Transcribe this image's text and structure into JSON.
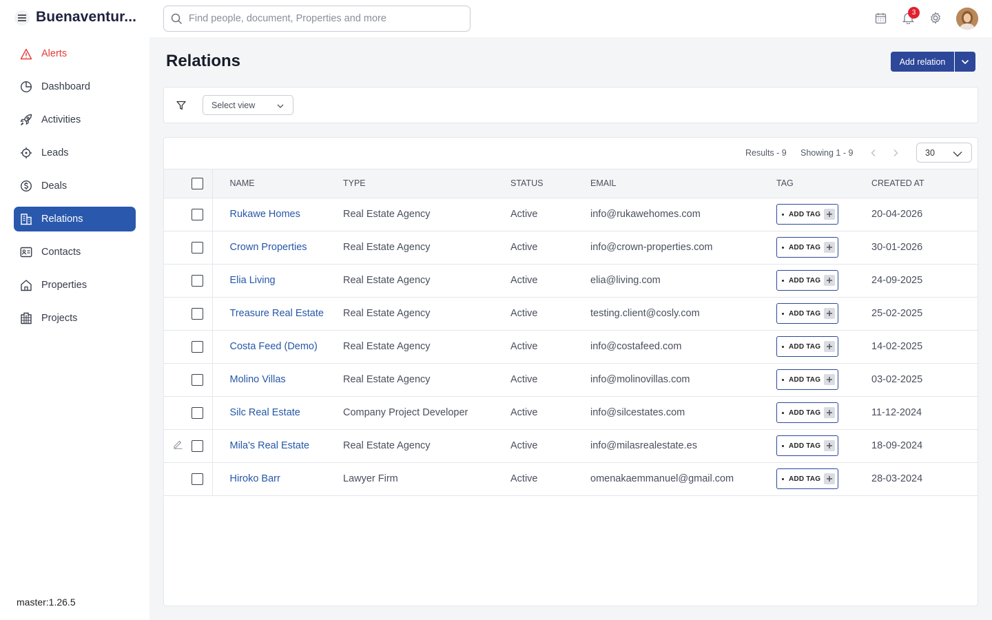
{
  "app": {
    "brand": "Buenaventur..."
  },
  "search": {
    "placeholder": "Find people, document, Properties and more"
  },
  "topbar": {
    "notification_count": "3"
  },
  "sidebar": {
    "items": [
      {
        "label": "Alerts",
        "icon": "alert-triangle-icon"
      },
      {
        "label": "Dashboard",
        "icon": "pie-chart-icon"
      },
      {
        "label": "Activities",
        "icon": "rocket-icon"
      },
      {
        "label": "Leads",
        "icon": "target-icon"
      },
      {
        "label": "Deals",
        "icon": "dollar-circle-icon"
      },
      {
        "label": "Relations",
        "icon": "building-icon"
      },
      {
        "label": "Contacts",
        "icon": "contact-card-icon"
      },
      {
        "label": "Properties",
        "icon": "home-icon"
      },
      {
        "label": "Projects",
        "icon": "grid-building-icon"
      }
    ],
    "active": "Relations",
    "version": "master:1.26.5"
  },
  "page": {
    "title": "Relations",
    "add_button": "Add relation"
  },
  "filters": {
    "select_view": "Select view"
  },
  "pager": {
    "results": "Results - 9",
    "showing": "Showing 1 - 9",
    "per_page": "30"
  },
  "table": {
    "columns": [
      "NAME",
      "TYPE",
      "STATUS",
      "EMAIL",
      "TAG",
      "CREATED AT"
    ],
    "add_tag_label": "ADD TAG",
    "rows": [
      {
        "name": "Rukawe Homes",
        "type": "Real Estate Agency",
        "status": "Active",
        "email": "info@rukawehomes.com",
        "created": "20-04-2026"
      },
      {
        "name": "Crown Properties",
        "type": "Real Estate Agency",
        "status": "Active",
        "email": "info@crown-properties.com",
        "created": "30-01-2026"
      },
      {
        "name": "Elia Living",
        "type": "Real Estate Agency",
        "status": "Active",
        "email": "elia@living.com",
        "created": "24-09-2025"
      },
      {
        "name": "Treasure Real Estate",
        "type": "Real Estate Agency",
        "status": "Active",
        "email": "testing.client@cosly.com",
        "created": "25-02-2025"
      },
      {
        "name": "Costa Feed (Demo)",
        "type": "Real Estate Agency",
        "status": "Active",
        "email": "info@costafeed.com",
        "created": "14-02-2025"
      },
      {
        "name": "Molino Villas",
        "type": "Real Estate Agency",
        "status": "Active",
        "email": "info@molinovillas.com",
        "created": "03-02-2025"
      },
      {
        "name": "Silc Real Estate",
        "type": "Company Project Developer",
        "status": "Active",
        "email": "info@silcestates.com",
        "created": "11-12-2024"
      },
      {
        "name": "Mila's Real Estate",
        "type": "Real Estate Agency",
        "status": "Active",
        "email": "info@milasrealestate.es",
        "created": "18-09-2024"
      },
      {
        "name": "Hiroko Barr",
        "type": "Lawyer Firm",
        "status": "Active",
        "email": "omenakaemmanuel@gmail.com",
        "created": "28-03-2024"
      }
    ]
  },
  "colors": {
    "primary": "#2d4799",
    "active_nav": "#2a58ad",
    "link": "#2557a7",
    "alert": "#e53a3a",
    "badge": "#e2202e"
  }
}
